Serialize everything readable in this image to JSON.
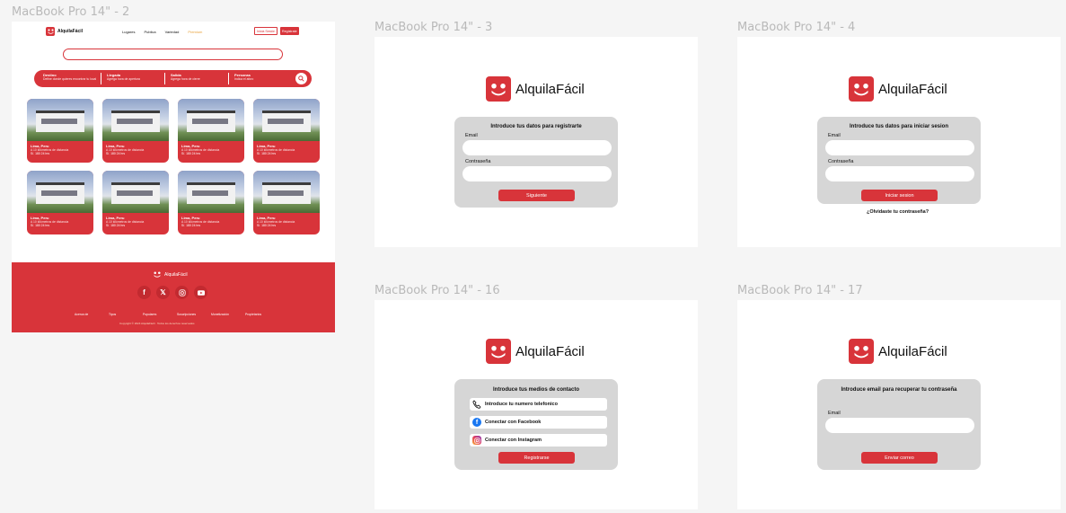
{
  "frames": {
    "f2": "MacBook Pro 14\" - 2",
    "f3": "MacBook Pro 14\" - 3",
    "f4": "MacBook Pro 14\" - 4",
    "f16": "MacBook Pro 14\" - 16",
    "f17": "MacBook Pro 14\" - 17"
  },
  "brand": "AlquilaFácil",
  "nav": {
    "links": [
      "Lugares",
      "Publica",
      "Variedad",
      "Premium"
    ],
    "login": "Inicia Sesión",
    "register": "Regístrate"
  },
  "filters": [
    {
      "title": "Destino",
      "sub": "Define donde quieres encontrar tu local"
    },
    {
      "title": "Llegada",
      "sub": "Agrega hora de apertura"
    },
    {
      "title": "Salida",
      "sub": "Agrega hora de cierre"
    },
    {
      "title": "Personas",
      "sub": "Indica el aforo"
    }
  ],
  "cards": [
    {
      "city": "Lima, Peru",
      "dist": "A 10 kilómetros de distancia",
      "price": "S/. 180 24 hrs"
    },
    {
      "city": "Lima, Peru",
      "dist": "A 10 kilómetros de distancia",
      "price": "S/. 180 24 hrs"
    },
    {
      "city": "Lima, Peru",
      "dist": "A 10 kilómetros de distancia",
      "price": "S/. 180 24 hrs"
    },
    {
      "city": "Lima, Peru",
      "dist": "A 10 kilómetros de distancia",
      "price": "S/. 180 24 hrs"
    },
    {
      "city": "Lima, Peru",
      "dist": "A 10 kilómetros de distancia",
      "price": "S/. 180 24 hrs"
    },
    {
      "city": "Lima, Peru",
      "dist": "A 10 kilómetros de distancia",
      "price": "S/. 180 24 hrs"
    },
    {
      "city": "Lima, Peru",
      "dist": "A 10 kilómetros de distancia",
      "price": "S/. 180 24 hrs"
    },
    {
      "city": "Lima, Peru",
      "dist": "A 10 kilómetros de distancia",
      "price": "S/. 180 24 hrs"
    }
  ],
  "footer": {
    "links": [
      "Acerca de",
      "Tipos",
      "Populares",
      "Suscripciones",
      "Monetización",
      "Propietarios"
    ],
    "copyright": "Copyright © 2024 AlquilaFácil · Todos los derechos reservados"
  },
  "register": {
    "title": "Introduce tus datos para registrarte",
    "email": "Email",
    "password": "Contraseña",
    "button": "Siguiente"
  },
  "login": {
    "title": "Introduce tus datos para iniciar sesion",
    "email": "Email",
    "password": "Contraseña",
    "button": "Iniciar sesion",
    "forgot": "¿Olvidaste tu contraseña?"
  },
  "contact": {
    "title": "Introduce tus medios de contacto",
    "phone": "Introduce tu numero telefonico",
    "facebook": "Conectar con Facebook",
    "instagram": "Conectar con Instagram",
    "button": "Registrarse"
  },
  "recover": {
    "title": "Introduce email para recuperar tu contraseña",
    "email": "Email",
    "button": "Enviar correo"
  },
  "colors": {
    "accent": "#d8343a",
    "premium": "#e8a23a",
    "panel": "#d6d6d6"
  }
}
